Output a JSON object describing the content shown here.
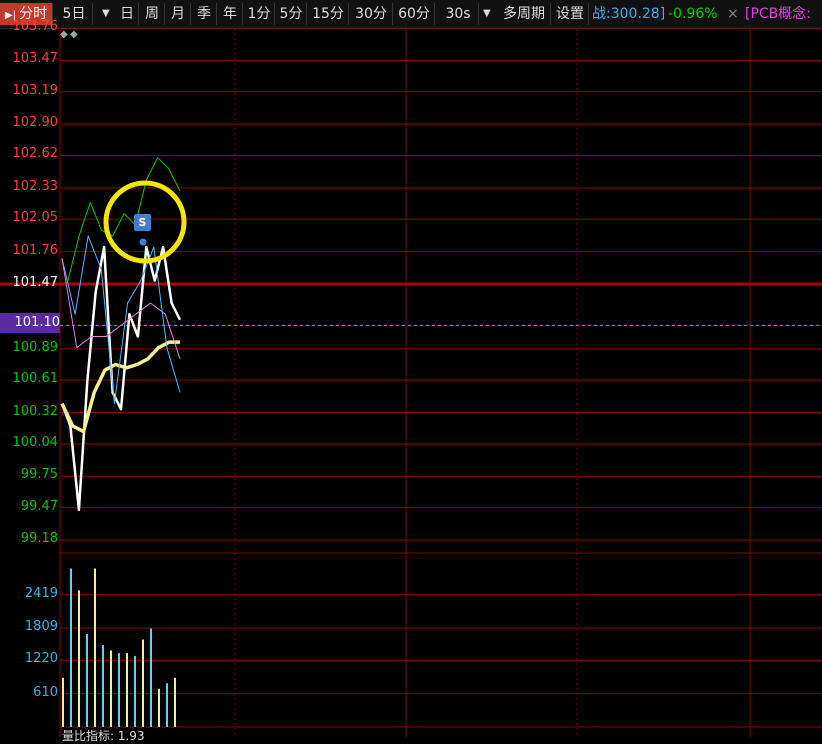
{
  "toolbar": {
    "buttons": [
      "分时",
      "5日",
      "日",
      "周",
      "月",
      "季",
      "年",
      "1分",
      "5分",
      "15分",
      "30分",
      "60分",
      "30s",
      "多周期",
      "设置"
    ],
    "active": "分时",
    "index_value": ":300.28]",
    "index_value_prefix": "战",
    "index_change": "-0.96%",
    "close_x": "×",
    "concept_tag": "[PCB概念:"
  },
  "price_axis": {
    "ticks": [
      "103.76",
      "103.47",
      "103.19",
      "102.90",
      "102.62",
      "102.33",
      "102.05",
      "101.76",
      "101.47",
      "101.10",
      "100.89",
      "100.61",
      "100.32",
      "100.04",
      "99.75",
      "99.47",
      "99.18"
    ],
    "current_price": "101.10",
    "reference_price": "101.47"
  },
  "volume_axis": {
    "ticks": [
      "2419",
      "1809",
      "1220",
      "610"
    ]
  },
  "marker_label": "S",
  "bottom_indicator": "量比指标: 1.93",
  "colors": {
    "grid": "#8b0000",
    "up": "#ff3b3b",
    "down": "#00c800",
    "price_line": "#ffffff",
    "avg_line": "#f5f08a",
    "green_line": "#00cc00",
    "blue_line": "#4fb7ff",
    "pink_line": "#e080e0",
    "highlight_circle": "#f5e600",
    "volume_up": "#f5f08a",
    "volume_down": "#4fd7ff"
  },
  "chart_data": {
    "type": "line",
    "series": [
      {
        "values": [
          100.4,
          100.2,
          99.45,
          100.6,
          101.4,
          101.8,
          100.5,
          100.35,
          101.2,
          101.0,
          101.8,
          101.5,
          101.8,
          101.3,
          101.15
        ]
      },
      {
        "values": [
          100.4,
          100.2,
          100.15,
          100.5,
          100.7,
          100.75,
          100.72,
          100.75,
          100.8,
          100.9,
          100.95,
          100.95
        ]
      },
      {
        "values": [
          101.5,
          101.9,
          102.2,
          101.95,
          101.9,
          102.1,
          102.0,
          102.4,
          102.6,
          102.5,
          102.3
        ]
      },
      {
        "values": [
          101.7,
          101.2,
          101.9,
          101.6,
          100.4,
          101.3,
          101.5,
          101.8,
          100.9,
          100.5
        ]
      },
      {
        "values": [
          101.7,
          100.9,
          101.0,
          101.0,
          101.1,
          101.2,
          101.3,
          101.2,
          100.8
        ]
      }
    ],
    "volume": [
      900,
      2900,
      2500,
      1700,
      2900,
      1500,
      1400,
      1350,
      1350,
      1300,
      1600,
      1800,
      700,
      800,
      900
    ]
  }
}
